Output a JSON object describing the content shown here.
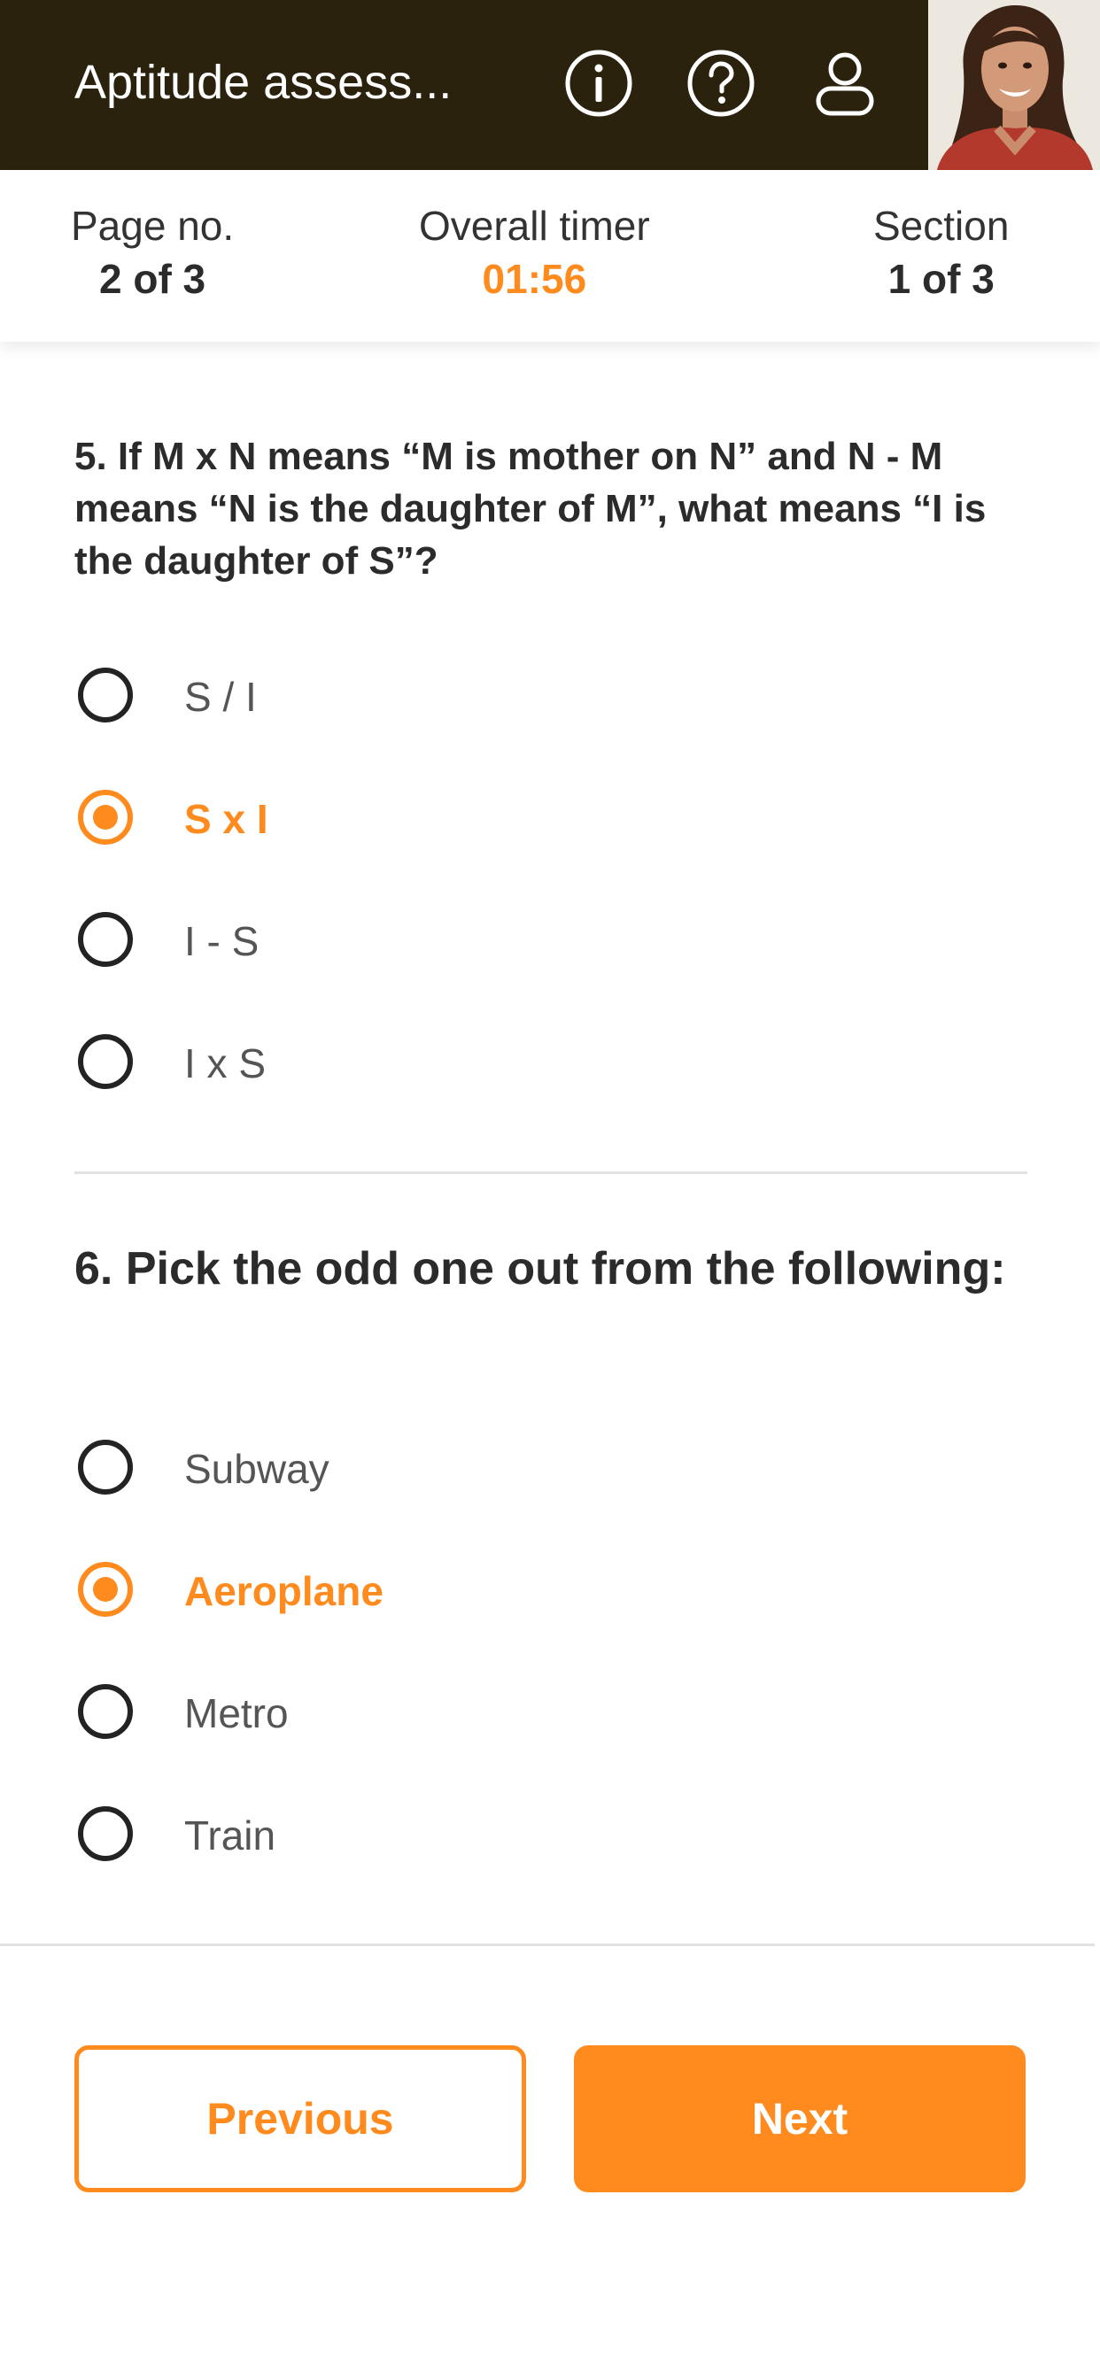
{
  "header": {
    "title": "Aptitude assess...",
    "icons": [
      "info-icon",
      "help-icon",
      "profile-icon"
    ]
  },
  "info_bar": {
    "page_label": "Page no.",
    "page_value": "2 of 3",
    "timer_label": "Overall timer",
    "timer_value": "01:56",
    "section_label": "Section",
    "section_value": "1 of 3"
  },
  "questions": [
    {
      "text": "5. If M x N means “M is mother on N” and N - M means “N is the daughter of M”, what means “I is the daughter of S”?",
      "options": [
        "S / I",
        "S x I",
        "I - S",
        "I x S"
      ],
      "selected": "S x I"
    },
    {
      "text": "6. Pick the odd one out from the following:",
      "options": [
        "Subway",
        "Aeroplane",
        "Metro",
        "Train"
      ],
      "selected": "Aeroplane"
    }
  ],
  "footer": {
    "previous_label": "Previous",
    "next_label": "Next"
  },
  "colors": {
    "accent": "#ff8a1e",
    "header_bg": "#2a220d",
    "text": "#2b2b2b"
  }
}
